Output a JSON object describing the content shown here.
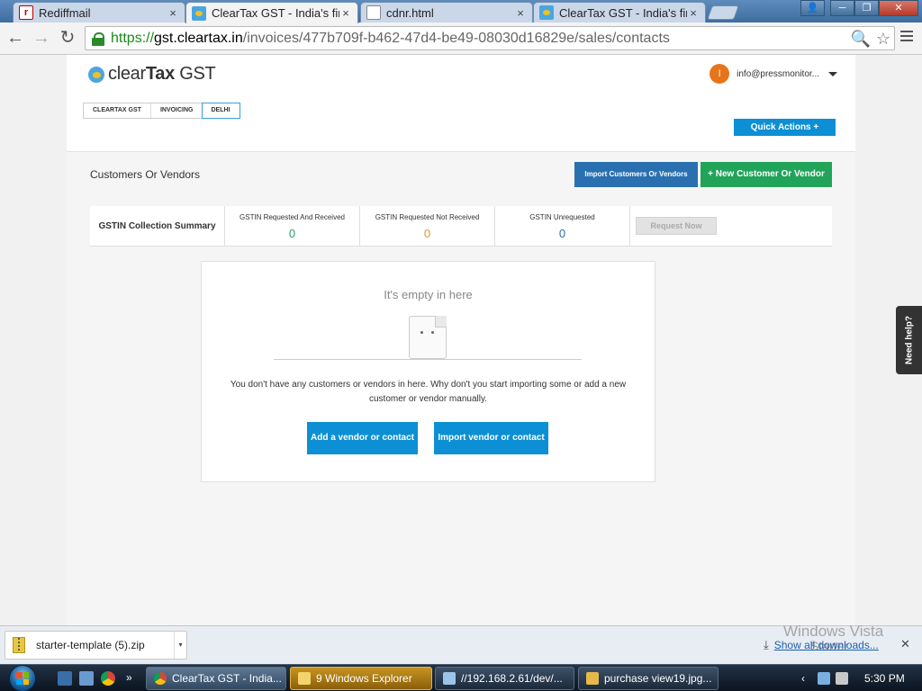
{
  "browser": {
    "tabs": [
      {
        "title": "Rediffmail",
        "close": "×",
        "active": false,
        "favicon": "rediffmail-favicon"
      },
      {
        "title": "ClearTax GST - India's first",
        "close": "×",
        "active": true,
        "favicon": "cleartax-favicon"
      },
      {
        "title": "cdnr.html",
        "close": "×",
        "active": false,
        "favicon": "document-favicon"
      },
      {
        "title": "ClearTax GST - India's first",
        "close": "×",
        "active": false,
        "favicon": "cleartax-favicon"
      }
    ],
    "window_buttons": {
      "user": "👤",
      "minimize": "─",
      "maximize": "❐",
      "close": "✕"
    },
    "nav": {
      "back": "←",
      "forward": "→",
      "reload": "↻"
    },
    "url": {
      "scheme": "https://",
      "host": "gst.cleartax.in",
      "path": "/invoices/477b709f-b462-47d4-be49-08030d16829e/sales/contacts"
    },
    "omnibox_icons": {
      "zoom": "🔍",
      "star": "☆"
    }
  },
  "app": {
    "logo_text_plain": "clear",
    "logo_text_bold": "Tax",
    "logo_text_suffix": " GST",
    "user": {
      "initial": "I",
      "email": "info@pressmonitor..."
    },
    "breadcrumb": [
      "CLEARTAX GST",
      "INVOICING",
      "DELHI"
    ],
    "quick_actions": "Quick Actions +"
  },
  "contacts": {
    "title": "Customers Or Vendors",
    "import_button": "Import Customers Or Vendors",
    "new_button": "+ New Customer Or Vendor",
    "summary": {
      "label": "GSTIN Collection Summary",
      "cells": [
        {
          "caption": "GSTIN Requested And Received",
          "value": "0"
        },
        {
          "caption": "GSTIN Requested Not Received",
          "value": "0"
        },
        {
          "caption": "GSTIN Unrequested",
          "value": "0"
        }
      ],
      "request_button": "Request Now"
    },
    "empty_state": {
      "title": "It's empty in here",
      "message": "You don't have any customers or vendors in here. Why don't you start importing some or add a new customer or vendor manually.",
      "add_button": "Add a vendor or contact",
      "import_button": "Import vendor or contact"
    }
  },
  "need_help": "Need help?",
  "downloads": {
    "file": "starter-template (5).zip",
    "caret": "▾",
    "show_all": "Show all downloads...",
    "download_icon": "⤓",
    "close": "✕"
  },
  "watermark": {
    "line1": "Windows Vista",
    "line2": "Starter"
  },
  "taskbar": {
    "buttons": [
      {
        "label": "ClearTax GST - India...",
        "icon": "chrome-icon"
      },
      {
        "label": "9 Windows Explorer",
        "icon": "folder-icon"
      },
      {
        "label": "//192.168.2.61/dev/...",
        "icon": "window-icon"
      },
      {
        "label": "purchase view19.jpg...",
        "icon": "image-icon"
      }
    ],
    "tray_arrow": "‹",
    "clock": "5:30 PM"
  },
  "colors": {
    "accent_blue": "#0c8fd4",
    "import_blue": "#2a6fb0",
    "new_green": "#22a35a",
    "value_green": "#27a06a",
    "value_orange": "#e8922a",
    "value_blue": "#2a6fb0",
    "avatar_orange": "#e8741a"
  }
}
